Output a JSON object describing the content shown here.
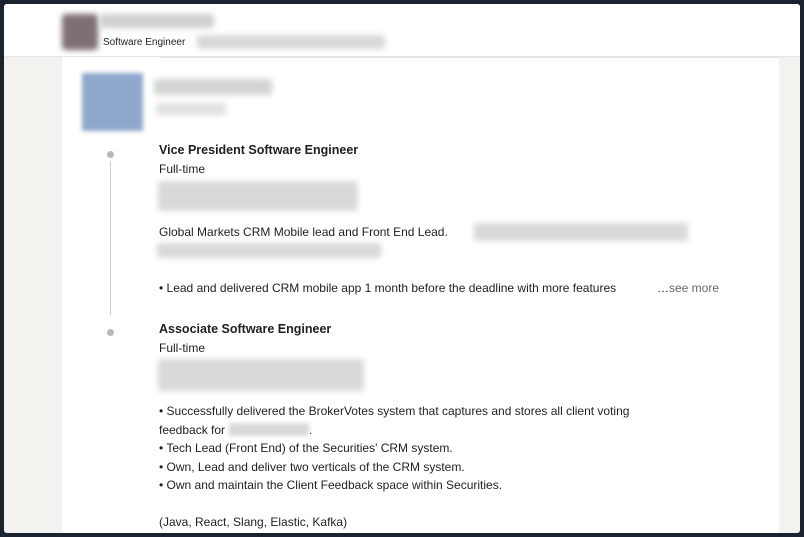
{
  "header": {
    "subtitle": "Software Engineer"
  },
  "experience": {
    "roles": [
      {
        "title": "Vice President Software Engineer",
        "employment_type": "Full-time",
        "description_intro": "Global Markets CRM Mobile lead and Front End Lead.",
        "bullet": "• Lead and delivered CRM mobile app 1 month before the deadline with more features",
        "ellipsis": "…",
        "see_more": "see more"
      },
      {
        "title": "Associate Software Engineer",
        "employment_type": "Full-time",
        "bullets": [
          "• Successfully delivered the BrokerVotes system that captures and stores all client voting",
          "feedback for",
          "• Tech Lead (Front End) of the Securities' CRM system.",
          "• Own, Lead and deliver two verticals of the CRM system.",
          "• Own and maintain the Client Feedback space within Securities."
        ],
        "period": ".",
        "skills": "(Java, React, Slang, Elastic, Kafka)"
      }
    ]
  },
  "colors": {
    "background": "#f3f2ef",
    "card": "#ffffff",
    "text": "#1f1f1f",
    "muted": "#666666",
    "frame": "#1b2330"
  }
}
